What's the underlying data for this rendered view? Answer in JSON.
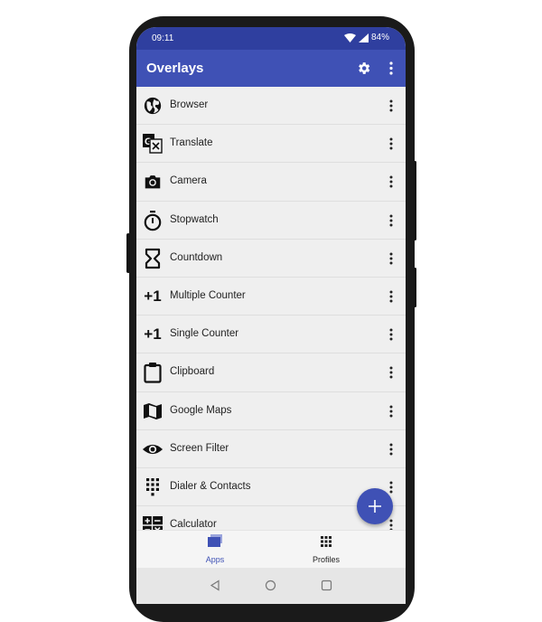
{
  "status": {
    "time": "09:11",
    "battery": "84%"
  },
  "toolbar": {
    "title": "Overlays",
    "settings_icon": "gear-icon",
    "overflow_icon": "more-vert-icon"
  },
  "items": [
    {
      "label": "Browser",
      "icon": "globe-icon"
    },
    {
      "label": "Translate",
      "icon": "translate-icon"
    },
    {
      "label": "Camera",
      "icon": "camera-icon"
    },
    {
      "label": "Stopwatch",
      "icon": "stopwatch-icon"
    },
    {
      "label": "Countdown",
      "icon": "hourglass-icon"
    },
    {
      "label": "Multiple Counter",
      "icon": "plus-one-icon",
      "icon_text": "+1"
    },
    {
      "label": "Single Counter",
      "icon": "plus-one-icon",
      "icon_text": "+1"
    },
    {
      "label": "Clipboard",
      "icon": "clipboard-icon"
    },
    {
      "label": "Google Maps",
      "icon": "map-icon"
    },
    {
      "label": "Screen Filter",
      "icon": "eye-icon"
    },
    {
      "label": "Dialer & Contacts",
      "icon": "dialpad-icon"
    },
    {
      "label": "Calculator",
      "icon": "calculator-icon"
    }
  ],
  "bottom_nav": {
    "apps_label": "Apps",
    "profiles_label": "Profiles"
  },
  "colors": {
    "primary": "#3f51b5",
    "primary_dark": "#2f3f9f",
    "background": "#efefef"
  }
}
